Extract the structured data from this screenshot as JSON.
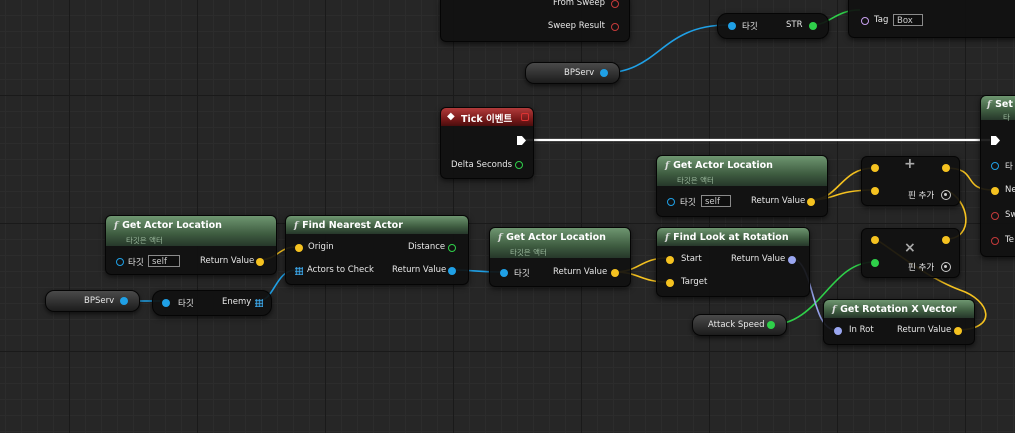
{
  "nodes": {
    "top_partial": {
      "from_sweep": "From Sweep",
      "sweep_result": "Sweep Result"
    },
    "target_str": {
      "target": "타깃",
      "out": "STR"
    },
    "tag_node": {
      "tag_label": "Tag",
      "tag_value": "Box"
    },
    "bpserv_top": {
      "label": "BPServ"
    },
    "tick": {
      "title": "Tick 이벤트",
      "delta": "Delta Seconds"
    },
    "set_partial": {
      "title": "Set",
      "sub": "타",
      "pins": [
        "타",
        "Ne",
        "Sw",
        "Te"
      ]
    },
    "gal_left": {
      "title": "Get Actor Location",
      "sub": "타깃은 액터",
      "target": "타깃",
      "self": "self",
      "ret": "Return Value"
    },
    "find_nearest": {
      "title": "Find Nearest Actor",
      "origin": "Origin",
      "distance": "Distance",
      "actors": "Actors to Check",
      "ret": "Return Value"
    },
    "gal_mid": {
      "title": "Get Actor Location",
      "sub": "타깃은 액터",
      "target": "타깃",
      "ret": "Return Value"
    },
    "gal_top": {
      "title": "Get Actor Location",
      "sub": "타깃은 액터",
      "target": "타깃",
      "self": "self",
      "ret": "Return Value"
    },
    "find_look": {
      "title": "Find Look at Rotation",
      "start": "Start",
      "target": "Target",
      "ret": "Return Value"
    },
    "add_node": {
      "op": "+",
      "add_pin": "핀 추가"
    },
    "mul_node": {
      "op": "×",
      "add_pin": "핀 추가"
    },
    "rot_x": {
      "title": "Get Rotation X Vector",
      "in": "In Rot",
      "ret": "Return Value"
    },
    "attack_speed": {
      "label": "Attack Speed"
    },
    "bpserv_bottom": {
      "label": "BPServ"
    },
    "target_enemy": {
      "target": "타깃",
      "out": "Enemy"
    }
  },
  "colors": {
    "exec": "#ffffff",
    "object": "#1fa0e6",
    "vector": "#f5c220",
    "float": "#2fd04a",
    "rotator": "#9aa6f0",
    "name": "#c8a0f0",
    "struct": "#c43a3a"
  }
}
